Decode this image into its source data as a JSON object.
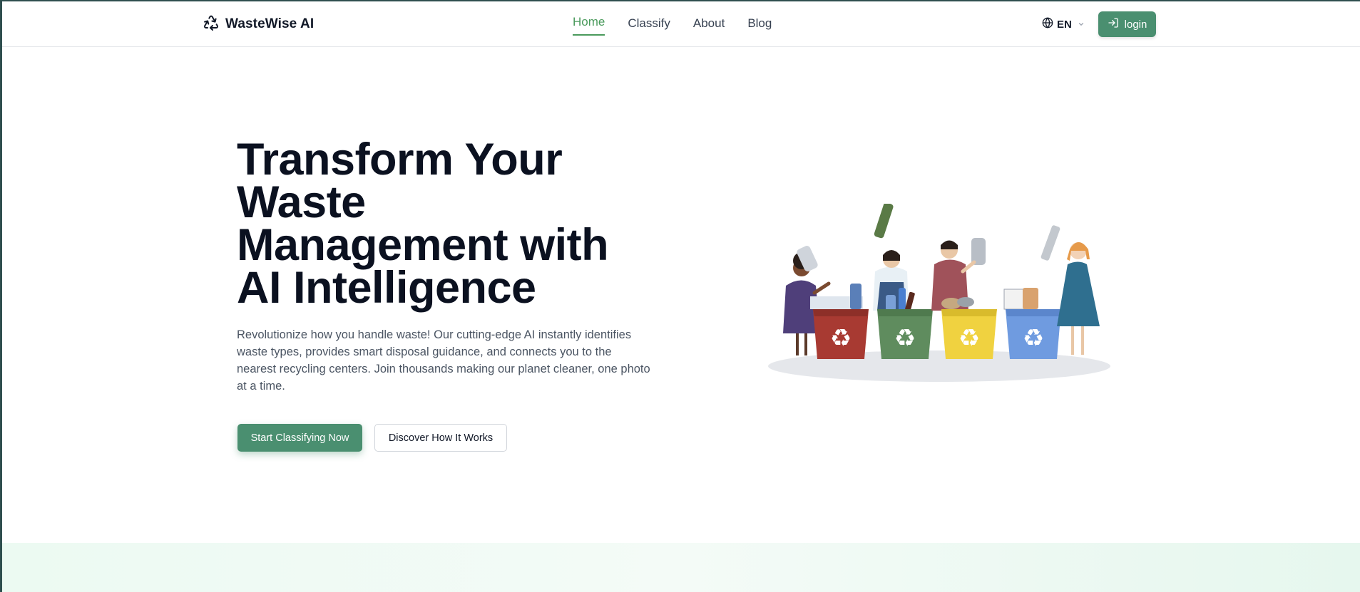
{
  "brand": {
    "name": "WasteWise AI",
    "logo_icon": "recycle-icon"
  },
  "nav": {
    "items": [
      {
        "label": "Home",
        "active": true
      },
      {
        "label": "Classify",
        "active": false
      },
      {
        "label": "About",
        "active": false
      },
      {
        "label": "Blog",
        "active": false
      }
    ]
  },
  "language": {
    "code": "EN",
    "icon": "globe-icon"
  },
  "login": {
    "label": "login",
    "icon": "sign-in-icon"
  },
  "hero": {
    "title_lines": [
      "Transform Your",
      "Waste",
      "Management with",
      "AI Intelligence"
    ],
    "description": "Revolutionize how you handle waste! Our cutting-edge AI instantly identifies waste types, provides smart disposal guidance, and connects you to the nearest recycling centers. Join thousands making our planet cleaner, one photo at a time.",
    "primary_cta": "Start Classifying Now",
    "secondary_cta": "Discover How It Works"
  },
  "colors": {
    "accent": "#4a8f70",
    "nav_active": "#4a9a5c",
    "bin_red": "#a83a32",
    "bin_green": "#5f8c5e",
    "bin_yellow": "#f0d240",
    "bin_blue": "#6f9be0"
  }
}
